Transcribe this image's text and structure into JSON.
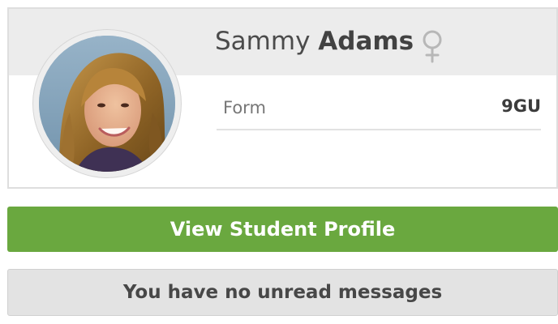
{
  "student": {
    "first_name": "Sammy",
    "last_name": "Adams",
    "gender_icon": "female-symbol-icon",
    "photo": "student-portrait"
  },
  "form": {
    "label": "Form",
    "value": "9GU"
  },
  "actions": {
    "view_profile_label": "View Student Profile"
  },
  "messages": {
    "text": "You have no unread messages"
  },
  "colors": {
    "button_green": "#6aa83f",
    "header_gray": "#ececec",
    "message_gray": "#e3e3e3"
  }
}
